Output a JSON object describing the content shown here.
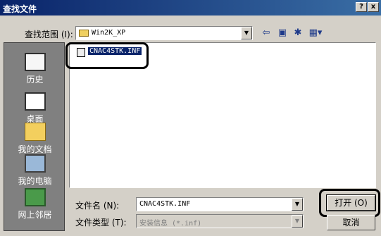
{
  "window": {
    "title": "查找文件",
    "help_label": "?",
    "close_label": "x"
  },
  "toolbar": {
    "lookin_label": "查找范围 (I):",
    "lookin_value": "Win2K_XP",
    "back_icon": "arrow-left-icon",
    "up_icon": "folder-up-icon",
    "new_folder_icon": "new-folder-icon",
    "view_icon": "view-menu-icon"
  },
  "places": [
    {
      "label": "历史",
      "icon": "history-icon"
    },
    {
      "label": "桌面",
      "icon": "desktop-icon"
    },
    {
      "label": "我的文档",
      "icon": "my-documents-icon"
    },
    {
      "label": "我的电脑",
      "icon": "my-computer-icon"
    },
    {
      "label": "网上邻居",
      "icon": "network-icon"
    }
  ],
  "files": [
    {
      "name": "CNAC4STK.INF",
      "selected": true
    }
  ],
  "fields": {
    "filename_label": "文件名 (N):",
    "filename_value": "CNAC4STK.INF",
    "filetype_label": "文件类型 (T):",
    "filetype_value": "安装信息 (*.inf)"
  },
  "buttons": {
    "open_label": "打开 (O)",
    "cancel_label": "取消"
  },
  "colors": {
    "titlebar": "#0a246a",
    "selection": "#0a246a",
    "places_bg": "#808080",
    "face": "#d4d0c8"
  }
}
